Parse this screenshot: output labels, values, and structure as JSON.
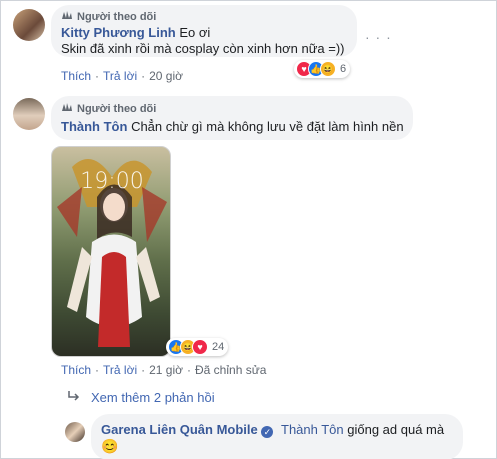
{
  "comment1": {
    "fan_label": "Người theo dõi",
    "author": "Kitty Phương Linh",
    "text_line1": "Eo ơi",
    "text_line2": "Skin đã xinh rồi mà cosplay còn xinh hơn nữa =))",
    "like": "Thích",
    "reply": "Trả lời",
    "time": "20 giờ",
    "reaction_count": "6",
    "more": "· · ·"
  },
  "comment2": {
    "fan_label": "Người theo dõi",
    "author": "Thành Tôn",
    "text": "Chẳn chừ gì mà không lưu về đặt làm hình nền",
    "like": "Thích",
    "reply": "Trả lời",
    "time": "21 giờ",
    "edited": "Đã chỉnh sửa",
    "reaction_count": "24",
    "phone_clock": "19:00"
  },
  "replies": {
    "view_more": "Xem thêm 2 phản hồi"
  },
  "reply1": {
    "author": "Garena Liên Quân Mobile",
    "mention": "Thành Tôn",
    "text": "giống ad quá mà",
    "emoji": "😊"
  },
  "colors": {
    "link": "#385898",
    "bubble": "#f2f3f5",
    "love": "#f0284a",
    "like": "#1877f2",
    "haha": "#f7b125"
  }
}
